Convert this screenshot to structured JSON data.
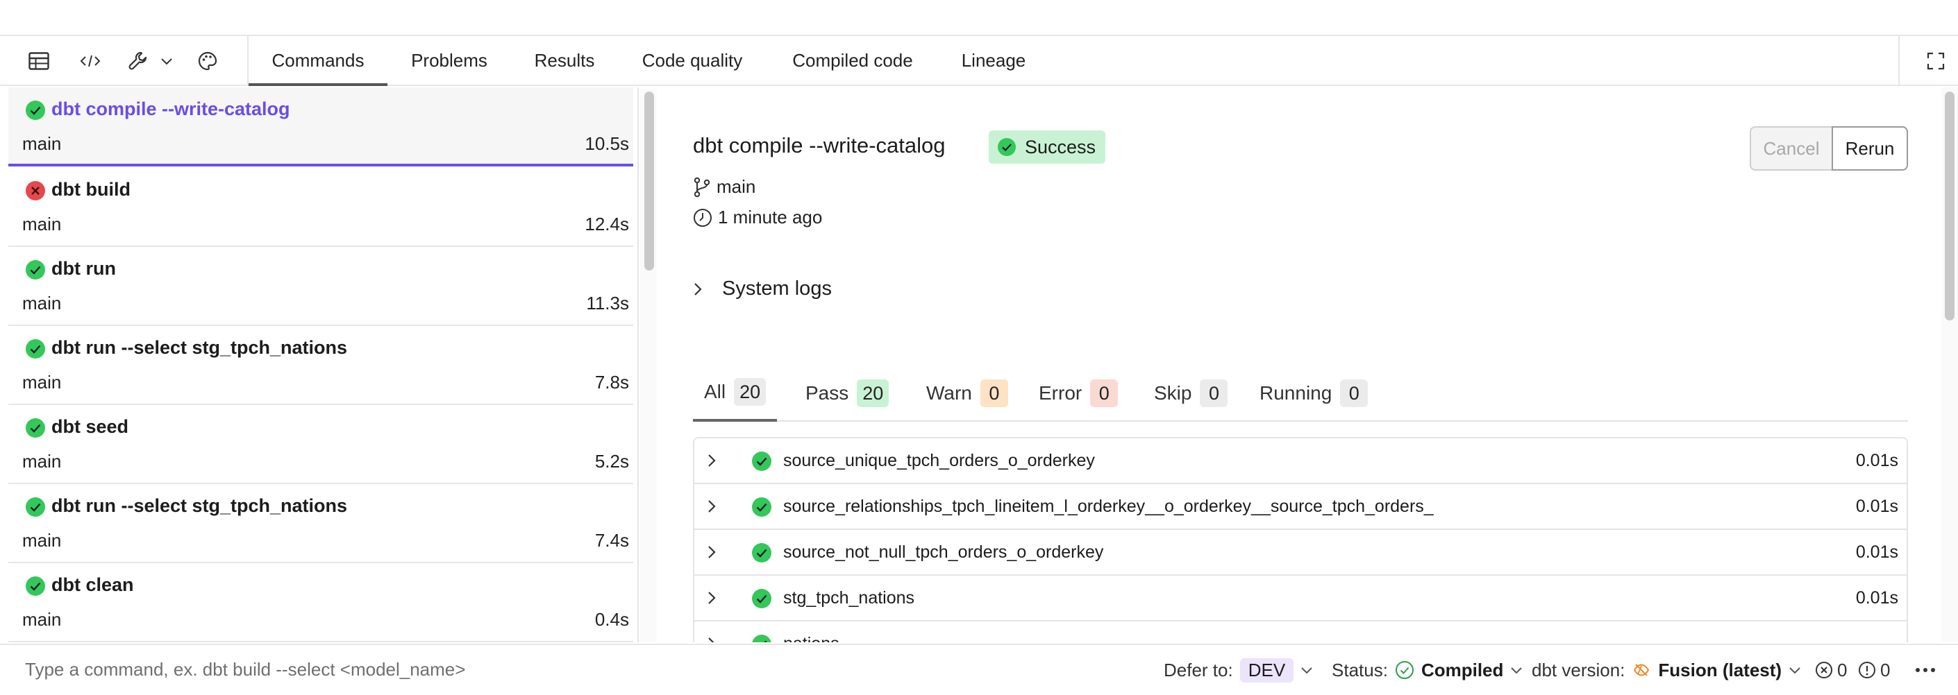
{
  "toolbar": {
    "icons": [
      "table-icon",
      "code-icon",
      "wrench-icon",
      "chevron-down-icon",
      "palette-icon",
      "expand-icon"
    ]
  },
  "tabs": [
    {
      "label": "Commands",
      "active": true
    },
    {
      "label": "Problems"
    },
    {
      "label": "Results"
    },
    {
      "label": "Code quality"
    },
    {
      "label": "Compiled code"
    },
    {
      "label": "Lineage"
    }
  ],
  "commands": [
    {
      "title": "dbt compile --write-catalog",
      "branch": "main",
      "duration": "10.5s",
      "status": "success",
      "selected": true
    },
    {
      "title": "dbt build",
      "branch": "main",
      "duration": "12.4s",
      "status": "error"
    },
    {
      "title": "dbt run",
      "branch": "main",
      "duration": "11.3s",
      "status": "success"
    },
    {
      "title": "dbt run --select stg_tpch_nations",
      "branch": "main",
      "duration": "7.8s",
      "status": "success"
    },
    {
      "title": "dbt seed",
      "branch": "main",
      "duration": "5.2s",
      "status": "success"
    },
    {
      "title": "dbt run --select stg_tpch_nations",
      "branch": "main",
      "duration": "7.4s",
      "status": "success"
    },
    {
      "title": "dbt clean",
      "branch": "main",
      "duration": "0.4s",
      "status": "success"
    }
  ],
  "detail": {
    "title": "dbt compile --write-catalog",
    "status_label": "Success",
    "branch": "main",
    "time_ago": "1 minute ago",
    "cancel_label": "Cancel",
    "rerun_label": "Rerun",
    "system_logs_label": "System logs"
  },
  "filters": [
    {
      "label": "All",
      "count": "20",
      "tone": "gray",
      "active": true
    },
    {
      "label": "Pass",
      "count": "20",
      "tone": "green"
    },
    {
      "label": "Warn",
      "count": "0",
      "tone": "orange"
    },
    {
      "label": "Error",
      "count": "0",
      "tone": "red"
    },
    {
      "label": "Skip",
      "count": "0",
      "tone": "gray"
    },
    {
      "label": "Running",
      "count": "0",
      "tone": "gray"
    }
  ],
  "results": [
    {
      "name": "source_unique_tpch_orders_o_orderkey",
      "time": "0.01s"
    },
    {
      "name": "source_relationships_tpch_lineitem_l_orderkey__o_orderkey__source_tpch_orders_",
      "time": "0.01s"
    },
    {
      "name": "source_not_null_tpch_orders_o_orderkey",
      "time": "0.01s"
    },
    {
      "name": "stg_tpch_nations",
      "time": "0.01s"
    },
    {
      "name": "nations",
      "time": ""
    }
  ],
  "statusbar": {
    "input_placeholder": "Type a command, ex. dbt build --select <model_name>",
    "defer_label": "Defer to:",
    "defer_value": "DEV",
    "status_label": "Status:",
    "status_value": "Compiled",
    "version_label": "dbt version:",
    "version_value": "Fusion (latest)",
    "errors_count": "0",
    "warnings_count": "0"
  },
  "colors": {
    "success": "#34c759",
    "error": "#e5484d",
    "accent": "#6a4de8"
  }
}
